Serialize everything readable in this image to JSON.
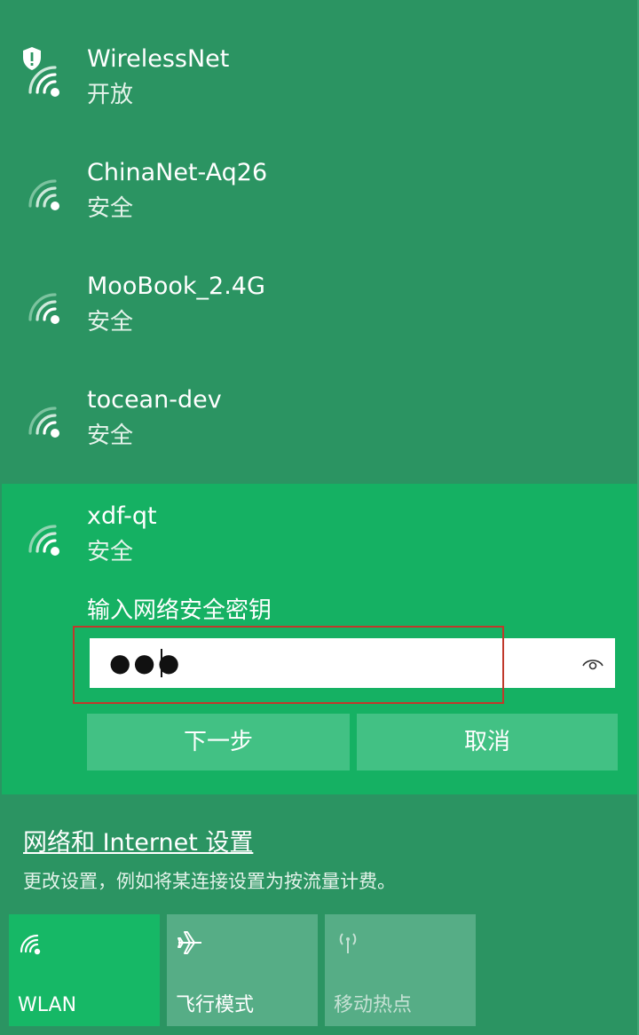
{
  "networks": [
    {
      "name": "WirelessNet",
      "status": "开放"
    },
    {
      "name": "ChinaNet-Aq26",
      "status": "安全"
    },
    {
      "name": "MooBook_2.4G",
      "status": "安全"
    },
    {
      "name": "tocean-dev",
      "status": "安全"
    }
  ],
  "selected": {
    "name": "xdf-qt",
    "status": "安全",
    "key_label": "输入网络安全密钥",
    "password_masked": "●●●",
    "next_label": "下一步",
    "cancel_label": "取消"
  },
  "settings": {
    "link": "网络和 Internet 设置",
    "description": "更改设置，例如将某连接设置为按流量计费。"
  },
  "tiles": {
    "wlan": "WLAN",
    "airplane": "飞行模式",
    "hotspot": "移动热点"
  },
  "colors": {
    "background": "#2b9462",
    "selected": "#15b163",
    "button": "#42c184",
    "tile_active": "#16b866",
    "tile_inactive": "#56ad86",
    "annotation": "#c0392b"
  },
  "icons": {
    "wifi": "wifi-icon",
    "shield": "shield-warning-icon",
    "eye": "eye-icon",
    "airplane": "airplane-icon",
    "hotspot": "hotspot-icon"
  }
}
